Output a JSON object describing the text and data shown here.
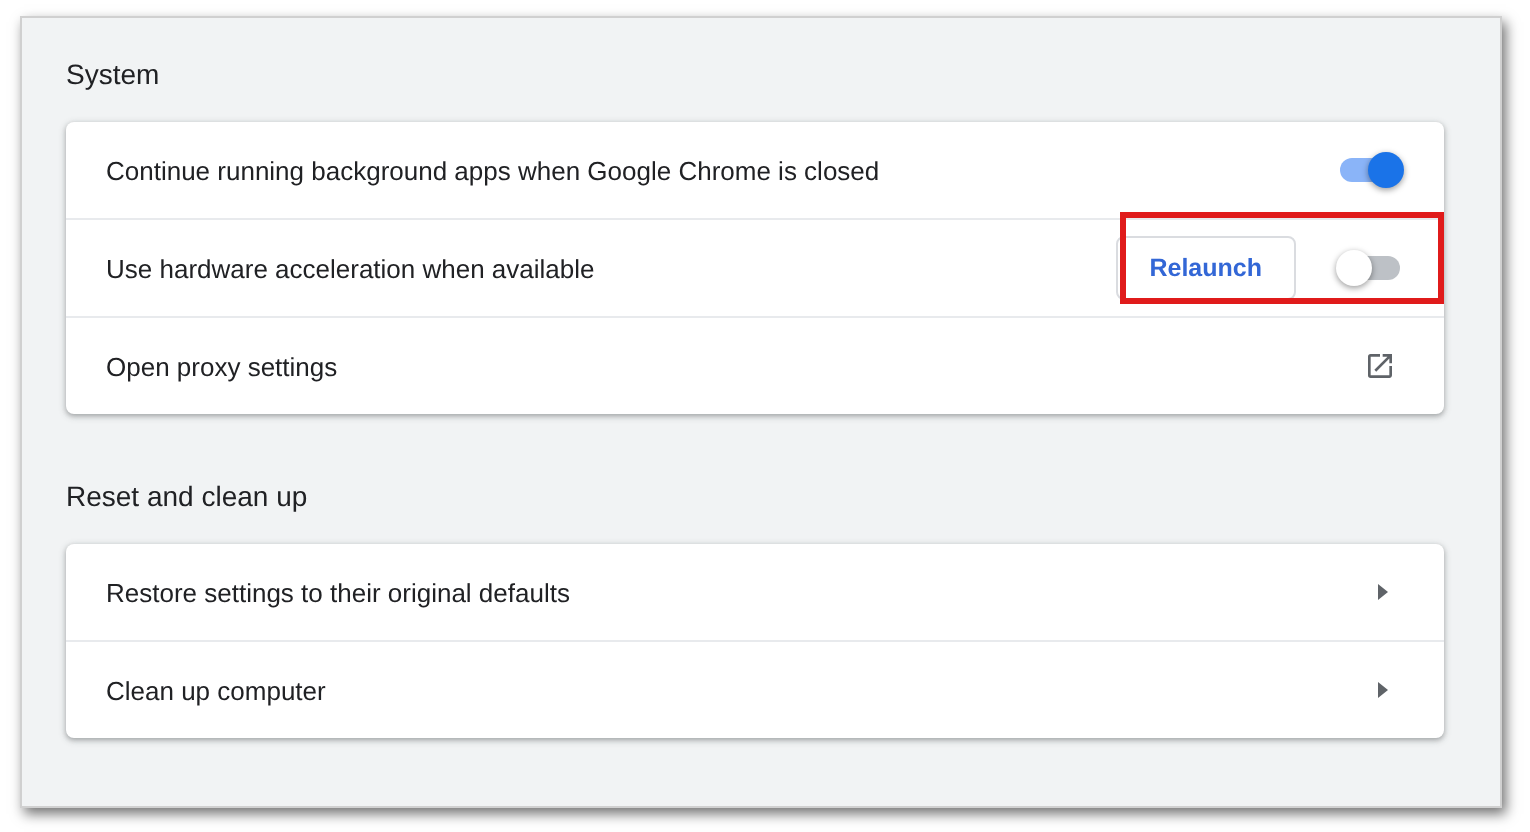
{
  "sections": [
    {
      "title": "System",
      "rows": [
        {
          "kind": "toggle",
          "label": "Continue running background apps when Google Chrome is closed",
          "on": true,
          "highlighted": false
        },
        {
          "kind": "toggle",
          "label": "Use hardware acceleration when available",
          "on": false,
          "button": "Relaunch",
          "highlighted": true
        },
        {
          "kind": "external",
          "label": "Open proxy settings"
        }
      ]
    },
    {
      "title": "Reset and clean up",
      "rows": [
        {
          "kind": "arrow",
          "label": "Restore settings to their original defaults"
        },
        {
          "kind": "arrow",
          "label": "Clean up computer"
        }
      ]
    }
  ]
}
